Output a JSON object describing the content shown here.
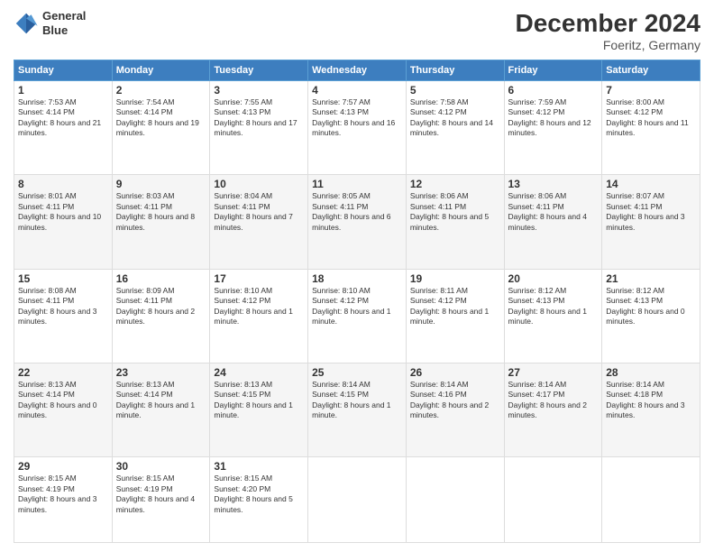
{
  "header": {
    "logo_line1": "General",
    "logo_line2": "Blue",
    "month": "December 2024",
    "location": "Foeritz, Germany"
  },
  "days_of_week": [
    "Sunday",
    "Monday",
    "Tuesday",
    "Wednesday",
    "Thursday",
    "Friday",
    "Saturday"
  ],
  "weeks": [
    [
      {
        "day": 1,
        "sunrise": "7:53 AM",
        "sunset": "4:14 PM",
        "daylight": "8 hours and 21 minutes."
      },
      {
        "day": 2,
        "sunrise": "7:54 AM",
        "sunset": "4:14 PM",
        "daylight": "8 hours and 19 minutes."
      },
      {
        "day": 3,
        "sunrise": "7:55 AM",
        "sunset": "4:13 PM",
        "daylight": "8 hours and 17 minutes."
      },
      {
        "day": 4,
        "sunrise": "7:57 AM",
        "sunset": "4:13 PM",
        "daylight": "8 hours and 16 minutes."
      },
      {
        "day": 5,
        "sunrise": "7:58 AM",
        "sunset": "4:12 PM",
        "daylight": "8 hours and 14 minutes."
      },
      {
        "day": 6,
        "sunrise": "7:59 AM",
        "sunset": "4:12 PM",
        "daylight": "8 hours and 12 minutes."
      },
      {
        "day": 7,
        "sunrise": "8:00 AM",
        "sunset": "4:12 PM",
        "daylight": "8 hours and 11 minutes."
      }
    ],
    [
      {
        "day": 8,
        "sunrise": "8:01 AM",
        "sunset": "4:11 PM",
        "daylight": "8 hours and 10 minutes."
      },
      {
        "day": 9,
        "sunrise": "8:03 AM",
        "sunset": "4:11 PM",
        "daylight": "8 hours and 8 minutes."
      },
      {
        "day": 10,
        "sunrise": "8:04 AM",
        "sunset": "4:11 PM",
        "daylight": "8 hours and 7 minutes."
      },
      {
        "day": 11,
        "sunrise": "8:05 AM",
        "sunset": "4:11 PM",
        "daylight": "8 hours and 6 minutes."
      },
      {
        "day": 12,
        "sunrise": "8:06 AM",
        "sunset": "4:11 PM",
        "daylight": "8 hours and 5 minutes."
      },
      {
        "day": 13,
        "sunrise": "8:06 AM",
        "sunset": "4:11 PM",
        "daylight": "8 hours and 4 minutes."
      },
      {
        "day": 14,
        "sunrise": "8:07 AM",
        "sunset": "4:11 PM",
        "daylight": "8 hours and 3 minutes."
      }
    ],
    [
      {
        "day": 15,
        "sunrise": "8:08 AM",
        "sunset": "4:11 PM",
        "daylight": "8 hours and 3 minutes."
      },
      {
        "day": 16,
        "sunrise": "8:09 AM",
        "sunset": "4:11 PM",
        "daylight": "8 hours and 2 minutes."
      },
      {
        "day": 17,
        "sunrise": "8:10 AM",
        "sunset": "4:12 PM",
        "daylight": "8 hours and 1 minute."
      },
      {
        "day": 18,
        "sunrise": "8:10 AM",
        "sunset": "4:12 PM",
        "daylight": "8 hours and 1 minute."
      },
      {
        "day": 19,
        "sunrise": "8:11 AM",
        "sunset": "4:12 PM",
        "daylight": "8 hours and 1 minute."
      },
      {
        "day": 20,
        "sunrise": "8:12 AM",
        "sunset": "4:13 PM",
        "daylight": "8 hours and 1 minute."
      },
      {
        "day": 21,
        "sunrise": "8:12 AM",
        "sunset": "4:13 PM",
        "daylight": "8 hours and 0 minutes."
      }
    ],
    [
      {
        "day": 22,
        "sunrise": "8:13 AM",
        "sunset": "4:14 PM",
        "daylight": "8 hours and 0 minutes."
      },
      {
        "day": 23,
        "sunrise": "8:13 AM",
        "sunset": "4:14 PM",
        "daylight": "8 hours and 1 minute."
      },
      {
        "day": 24,
        "sunrise": "8:13 AM",
        "sunset": "4:15 PM",
        "daylight": "8 hours and 1 minute."
      },
      {
        "day": 25,
        "sunrise": "8:14 AM",
        "sunset": "4:15 PM",
        "daylight": "8 hours and 1 minute."
      },
      {
        "day": 26,
        "sunrise": "8:14 AM",
        "sunset": "4:16 PM",
        "daylight": "8 hours and 2 minutes."
      },
      {
        "day": 27,
        "sunrise": "8:14 AM",
        "sunset": "4:17 PM",
        "daylight": "8 hours and 2 minutes."
      },
      {
        "day": 28,
        "sunrise": "8:14 AM",
        "sunset": "4:18 PM",
        "daylight": "8 hours and 3 minutes."
      }
    ],
    [
      {
        "day": 29,
        "sunrise": "8:15 AM",
        "sunset": "4:19 PM",
        "daylight": "8 hours and 3 minutes."
      },
      {
        "day": 30,
        "sunrise": "8:15 AM",
        "sunset": "4:19 PM",
        "daylight": "8 hours and 4 minutes."
      },
      {
        "day": 31,
        "sunrise": "8:15 AM",
        "sunset": "4:20 PM",
        "daylight": "8 hours and 5 minutes."
      },
      null,
      null,
      null,
      null
    ]
  ]
}
